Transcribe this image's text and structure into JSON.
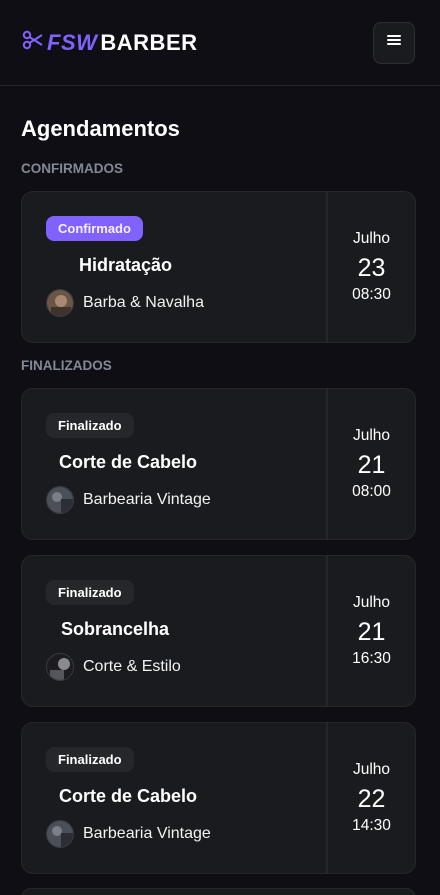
{
  "header": {
    "logo_fsw": "FSW",
    "logo_barber": "BARBER",
    "menu_icon": "menu-icon"
  },
  "page": {
    "title": "Agendamentos"
  },
  "sections": {
    "confirmed_title": "CONFIRMADOS",
    "finished_title": "FINALIZADOS"
  },
  "confirmed": [
    {
      "status": "Confirmado",
      "service": "Hidratação",
      "barbershop": "Barba & Navalha",
      "month": "Julho",
      "day": "23",
      "time": "08:30"
    }
  ],
  "finished": [
    {
      "status": "Finalizado",
      "service": "Corte de Cabelo",
      "barbershop": "Barbearia Vintage",
      "month": "Julho",
      "day": "21",
      "time": "08:00"
    },
    {
      "status": "Finalizado",
      "service": "Sobrancelha",
      "barbershop": "Corte & Estilo",
      "month": "Julho",
      "day": "21",
      "time": "16:30"
    },
    {
      "status": "Finalizado",
      "service": "Corte de Cabelo",
      "barbershop": "Barbearia Vintage",
      "month": "Julho",
      "day": "22",
      "time": "14:30"
    }
  ],
  "colors": {
    "accent": "#8162ff",
    "background": "#0f0e14",
    "card": "#1a1b1f"
  }
}
